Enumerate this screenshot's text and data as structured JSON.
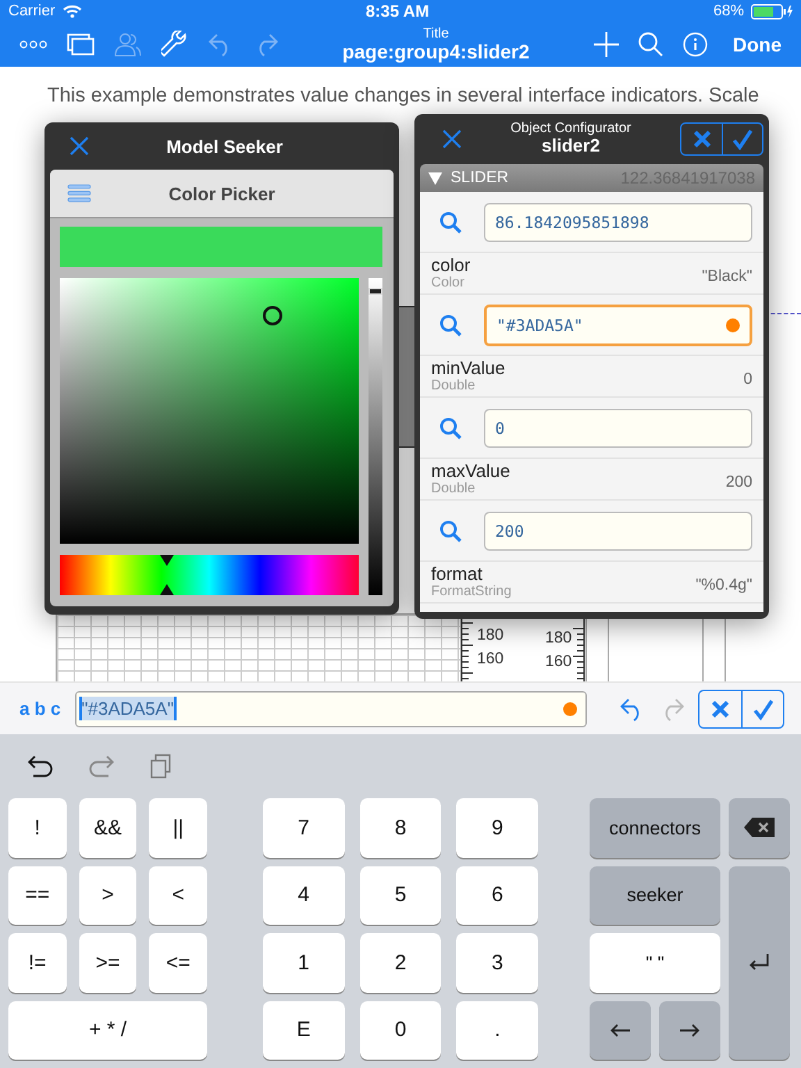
{
  "status_bar": {
    "carrier": "Carrier",
    "time": "8:35 AM",
    "battery": "68%"
  },
  "nav_bar": {
    "caption": "Title",
    "title": "page:group4:slider2",
    "done": "Done"
  },
  "background": {
    "paragraph": "This example demonstrates value changes in several interface indicators. Scale",
    "gauge_labels": [
      "180",
      "160",
      "180",
      "160"
    ]
  },
  "model_seeker": {
    "title": "Model Seeker",
    "picker_title": "Color Picker",
    "color": "#3ada5a",
    "hue_slider": {
      "level": 0.36
    },
    "brightness_slider": {
      "level": 0.97
    }
  },
  "configurator": {
    "caption": "Object Configurator",
    "title": "slider2",
    "section": "SLIDER",
    "section_value": "122.36841917038",
    "rows": [
      {
        "kind": "field",
        "value": "86.1842095851898",
        "focused": false,
        "modified": false
      },
      {
        "kind": "property",
        "name": "color",
        "type": "Color",
        "value": "\"Black\""
      },
      {
        "kind": "field",
        "value": "\"#3ADA5A\"",
        "focused": true,
        "modified": true
      },
      {
        "kind": "property",
        "name": "minValue",
        "type": "Double",
        "value": "0"
      },
      {
        "kind": "field",
        "value": "0",
        "focused": false,
        "modified": false
      },
      {
        "kind": "property",
        "name": "maxValue",
        "type": "Double",
        "value": "200"
      },
      {
        "kind": "field",
        "value": "200",
        "focused": false,
        "modified": false
      },
      {
        "kind": "property",
        "name": "format",
        "type": "FormatString",
        "value": "\"%0.4g\""
      }
    ]
  },
  "editor": {
    "mode": "a b c",
    "value": "\"#3ADA5A\"",
    "modified": true
  },
  "keyboard": {
    "left": [
      "!",
      "&&",
      "||",
      "==",
      ">",
      "<",
      "!=",
      ">=",
      "<=",
      "+ * /"
    ],
    "digits": [
      "7",
      "8",
      "9",
      "4",
      "5",
      "6",
      "1",
      "2",
      "3",
      "E",
      "0",
      "."
    ],
    "right": [
      {
        "kind": "gray",
        "label": "connectors"
      },
      {
        "kind": "backspace"
      },
      {
        "kind": "gray",
        "label": "seeker"
      },
      {
        "kind": "white",
        "label": "\" \""
      },
      {
        "kind": "return"
      },
      {
        "kind": "left"
      },
      {
        "kind": "right"
      }
    ]
  }
}
